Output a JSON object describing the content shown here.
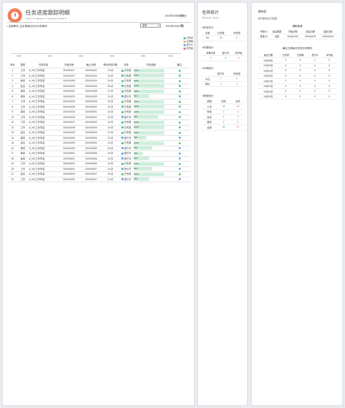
{
  "header": {
    "title": "任务进度跟踪明细",
    "subtitle": "Task Progress Tracking Details",
    "date": "2024年05月02日",
    "check_label": "查询日"
  },
  "chart_bar": {
    "label": "• 全部概况_近五周每日总计分布情况",
    "select_value": "全部",
    "date": "2024年05月13日"
  },
  "legend": [
    {
      "label": "已完成",
      "color": "#5bc48a"
    },
    {
      "label": "已到期",
      "color": "#f0b35a"
    },
    {
      "label": "进行中",
      "color": "#6aa6e8"
    },
    {
      "label": "未开始",
      "color": "#e57373"
    }
  ],
  "axis_ticks": [
    "04/08",
    "04/15",
    "04/22",
    "04/29",
    "05/06",
    "05/13"
  ],
  "table": {
    "headers": [
      "序号",
      "类型",
      "任务内容",
      "开始日期",
      "截止日期",
      "剩余完成天数",
      "状态",
      "任务进度",
      "备注"
    ],
    "rows": [
      [
        "1",
        "工作",
        "A_NC工作内容",
        "2024/04/17",
        "2024/04/24",
        "24 天",
        "已完成",
        "100%"
      ],
      [
        "2",
        "工作",
        "A_NC工作内容",
        "2024/04/17",
        "2024/04/24",
        "24 天",
        "已完成",
        "100%"
      ],
      [
        "3",
        "休息",
        "A_NC工作内容",
        "2024/04/18",
        "2024/04/25",
        "24 天",
        "已完成",
        "100%"
      ],
      [
        "4",
        "会议",
        "A_NC工作内容",
        "2024/04/20",
        "2024/04/25",
        "26 天",
        "已完成",
        "100%"
      ],
      [
        "5",
        "事务",
        "A_NC工作内容",
        "2024/04/22",
        "2024/04/28",
        "24 天",
        "已完成",
        "100%"
      ],
      [
        "6",
        "事务",
        "A_NC工作内容",
        "2024/04/23",
        "2024/04/29",
        "24 天",
        "进行中",
        "50%"
      ],
      [
        "7",
        "工作",
        "A_NC工作内容",
        "2024/04/23",
        "2024/04/29",
        "24 天",
        "已完成",
        "100%"
      ],
      [
        "8",
        "工作",
        "A_NC工作内容",
        "2024/04/25",
        "2024/05/01",
        "24 天",
        "已完成",
        "100%"
      ],
      [
        "9",
        "事务",
        "A_NC工作内容",
        "2024/04/26",
        "2024/05/01",
        "24 天",
        "已完成",
        "100%"
      ],
      [
        "10",
        "工作",
        "A_NC工作内容",
        "2024/04/26",
        "2024/05/02",
        "24 天",
        "进行中",
        "80%"
      ],
      [
        "11",
        "工作",
        "A_NC工作内容",
        "2024/04/27",
        "2024/05/02",
        "24 天",
        "已完成",
        "100%"
      ],
      [
        "12",
        "工作",
        "A_NC工作内容",
        "2024/04/28",
        "2024/05/03",
        "24 天",
        "已完成",
        "100%"
      ],
      [
        "13",
        "会议",
        "A_NC工作内容",
        "2024/04/29",
        "2024/05/03",
        "24 天",
        "已完成",
        "100%"
      ],
      [
        "14",
        "事务",
        "A_NC工作内容",
        "2024/04/29",
        "2024/05/04",
        "24 天",
        "进行中",
        "40%"
      ],
      [
        "15",
        "会议",
        "A_NC工作内容",
        "2024/04/30",
        "2024/05/04",
        "24 天",
        "已完成",
        "100%"
      ],
      [
        "16",
        "事务",
        "A_NC工作内容",
        "2024/04/30",
        "2024/05/05",
        "24 天",
        "进行中",
        "60%"
      ],
      [
        "17",
        "事务",
        "A_NC工作内容",
        "2024/05/01",
        "2024/05/05",
        "24 天",
        "进行中",
        "30%"
      ],
      [
        "18",
        "休息",
        "A_NC工作内容",
        "2024/05/01",
        "2024/05/06",
        "24 天",
        "进行中",
        "50%"
      ],
      [
        "19",
        "工作",
        "A_NC工作内容",
        "2024/05/01",
        "2024/05/06",
        "24 天",
        "已完成",
        "100%"
      ],
      [
        "20",
        "工作",
        "A_NC工作内容",
        "2024/05/01",
        "2024/05/07",
        "24 天",
        "进行中",
        "60%"
      ],
      [
        "21",
        "会议",
        "A_NC工作内容",
        "2024/05/02",
        "2024/05/07",
        "24 天",
        "已完成",
        "100%"
      ],
      [
        "22",
        "工作",
        "A_NC工作内容",
        "2024/05/02",
        "2024/05/07",
        "24 天",
        "进行中",
        "50%"
      ]
    ]
  },
  "stats": {
    "title": "任务统计",
    "subtitle": "Mission Stats",
    "s1_title": "●任务总计",
    "s1_headers": [
      "全部",
      "已完成",
      "未完成"
    ],
    "s1_values": [
      "53",
      "26",
      "27"
    ],
    "s2_title": "●本周统计",
    "s2_headers": [
      "本周未完",
      "进行中",
      "未开始"
    ],
    "s2_values": [
      "0",
      "0",
      "0"
    ],
    "s3_title": "●今明统计",
    "s3_rows": [
      [
        "今日",
        "7",
        "0"
      ],
      [
        "明日",
        "1",
        "2"
      ]
    ],
    "s4_title": "●类型统计",
    "s4_headers": [
      "类型",
      "完成",
      "未完"
    ],
    "s4_rows": [
      [
        "工作",
        "18",
        "15"
      ],
      [
        "休息",
        "2",
        "3"
      ],
      [
        "会议",
        "4",
        "3"
      ],
      [
        "事务",
        "3",
        "5"
      ],
      [
        "全部",
        "26",
        "27"
      ]
    ]
  },
  "notes": {
    "title": "随响表",
    "hint": "请勿更改此栏数据",
    "head": "辅助数据",
    "r1": [
      "停顿1/1",
      "最高推数",
      "开始日期",
      "最高日期",
      "结束日期"
    ],
    "r2": [
      "数量1/1",
      "全部",
      "2024/04/16",
      "2024/04/29",
      "2024/05/13"
    ],
    "dist_title": "最近五周每日任务分布情况",
    "dist_headers": [
      "最近日期",
      "已完成",
      "已到期",
      "进行中",
      "未开始"
    ],
    "dist_rows": [
      [
        "04月08日",
        "0",
        "0",
        "0",
        "0"
      ],
      [
        "04月09日",
        "0",
        "0",
        "0",
        "0"
      ],
      [
        "04月10日",
        "0",
        "0",
        "0",
        "0"
      ],
      [
        "04月11日",
        "0",
        "0",
        "0",
        "0"
      ],
      [
        "04月12日",
        "0",
        "0",
        "0",
        "0"
      ],
      [
        "04月13日",
        "0",
        "0",
        "0",
        "0"
      ],
      [
        "04月14日",
        "0",
        "0",
        "0",
        "0"
      ],
      [
        "04月15日",
        "0",
        "0",
        "0",
        "0"
      ]
    ]
  }
}
